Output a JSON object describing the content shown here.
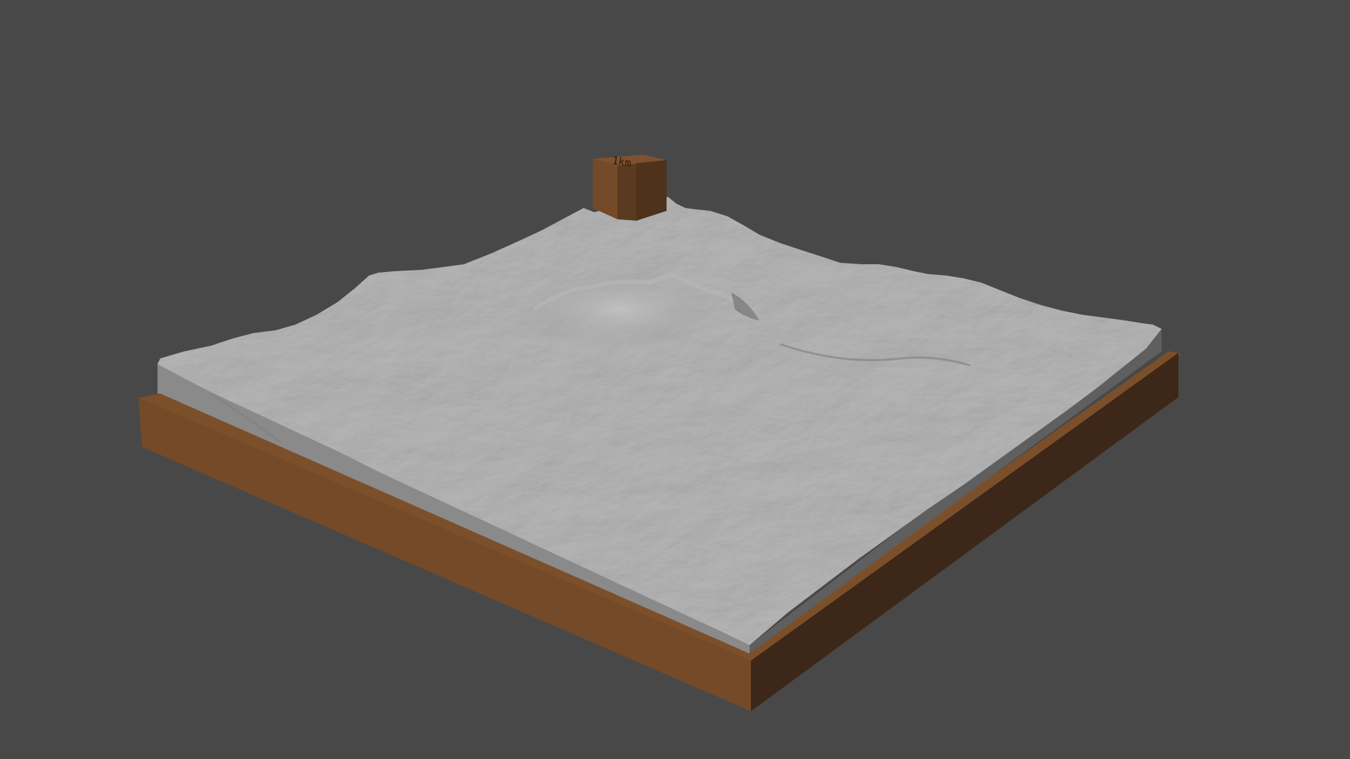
{
  "scene": {
    "background_color": "#484848",
    "terrain_color": "#9a9a9a",
    "base_color": "#744a28",
    "base_side_color": "#3c2718",
    "cube_label": "1km"
  }
}
